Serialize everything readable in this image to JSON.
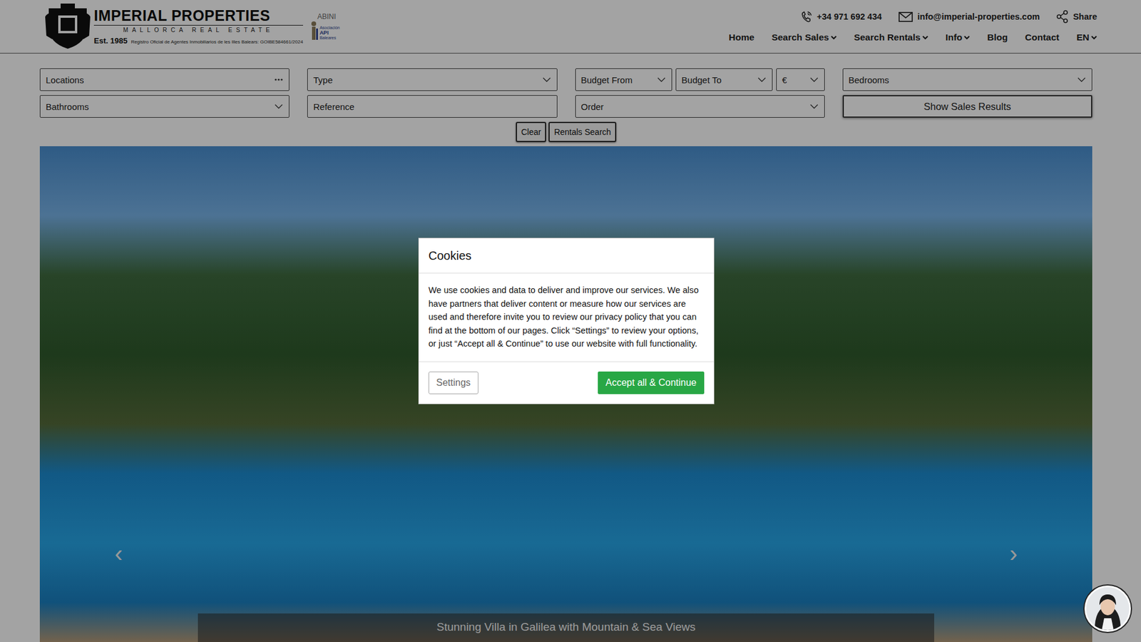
{
  "header": {
    "logo": {
      "name": "IMPERIAL PROPERTIES",
      "subtitle": "MALLORCA REAL ESTATE",
      "established": "Est. 1985",
      "registry": "Registro Oficial de Agentes Inmobiliarios de les Illes Balears: GOIBE584661/2024",
      "partner": "ABINI",
      "partner_line1": "Asociación",
      "partner_api": "API",
      "partner_line2": "Baleares"
    },
    "contact": {
      "phone": "+34 971 692 434",
      "email": "info@imperial-properties.com",
      "share": "Share"
    },
    "nav": [
      {
        "label": "Home",
        "has_menu": false
      },
      {
        "label": "Search Sales",
        "has_menu": true
      },
      {
        "label": "Search Rentals",
        "has_menu": true
      },
      {
        "label": "Info",
        "has_menu": true
      },
      {
        "label": "Blog",
        "has_menu": false
      },
      {
        "label": "Contact",
        "has_menu": false
      },
      {
        "label": "EN",
        "has_menu": true
      }
    ]
  },
  "search": {
    "rows": [
      [
        {
          "kind": "multi",
          "label": "Locations"
        },
        {
          "kind": "select",
          "label": "Type"
        },
        {
          "kind": "group",
          "fields": [
            {
              "kind": "select",
              "label": "Budget From"
            },
            {
              "kind": "select",
              "label": "Budget To"
            },
            {
              "kind": "select",
              "label": "€"
            }
          ]
        },
        {
          "kind": "select",
          "label": "Bedrooms"
        }
      ],
      [
        {
          "kind": "select",
          "label": "Bathrooms"
        },
        {
          "kind": "text",
          "label": "Reference"
        },
        {
          "kind": "select",
          "label": "Order"
        },
        {
          "kind": "submit",
          "label": "Show Sales Results"
        }
      ]
    ],
    "actions": [
      "Clear",
      "Rentals Search"
    ]
  },
  "hero": {
    "prev": "‹",
    "next": "›",
    "caption": "Stunning Villa in Galilea with Mountain & Sea Views"
  },
  "cookie_dialog": {
    "title": "Cookies",
    "body": "We use cookies and data to deliver and improve our services. We also have partners that deliver content or measure how our services are used and therefore invite you to review our privacy policy that you can find at the bottom of our pages. Click “Settings” to review your options, or just “Accept all & Continue” to use our website with full functionality.",
    "buttons": [
      {
        "label": "Settings",
        "kind": "secondary"
      },
      {
        "label": "Accept all & Continue",
        "kind": "primary"
      }
    ]
  }
}
